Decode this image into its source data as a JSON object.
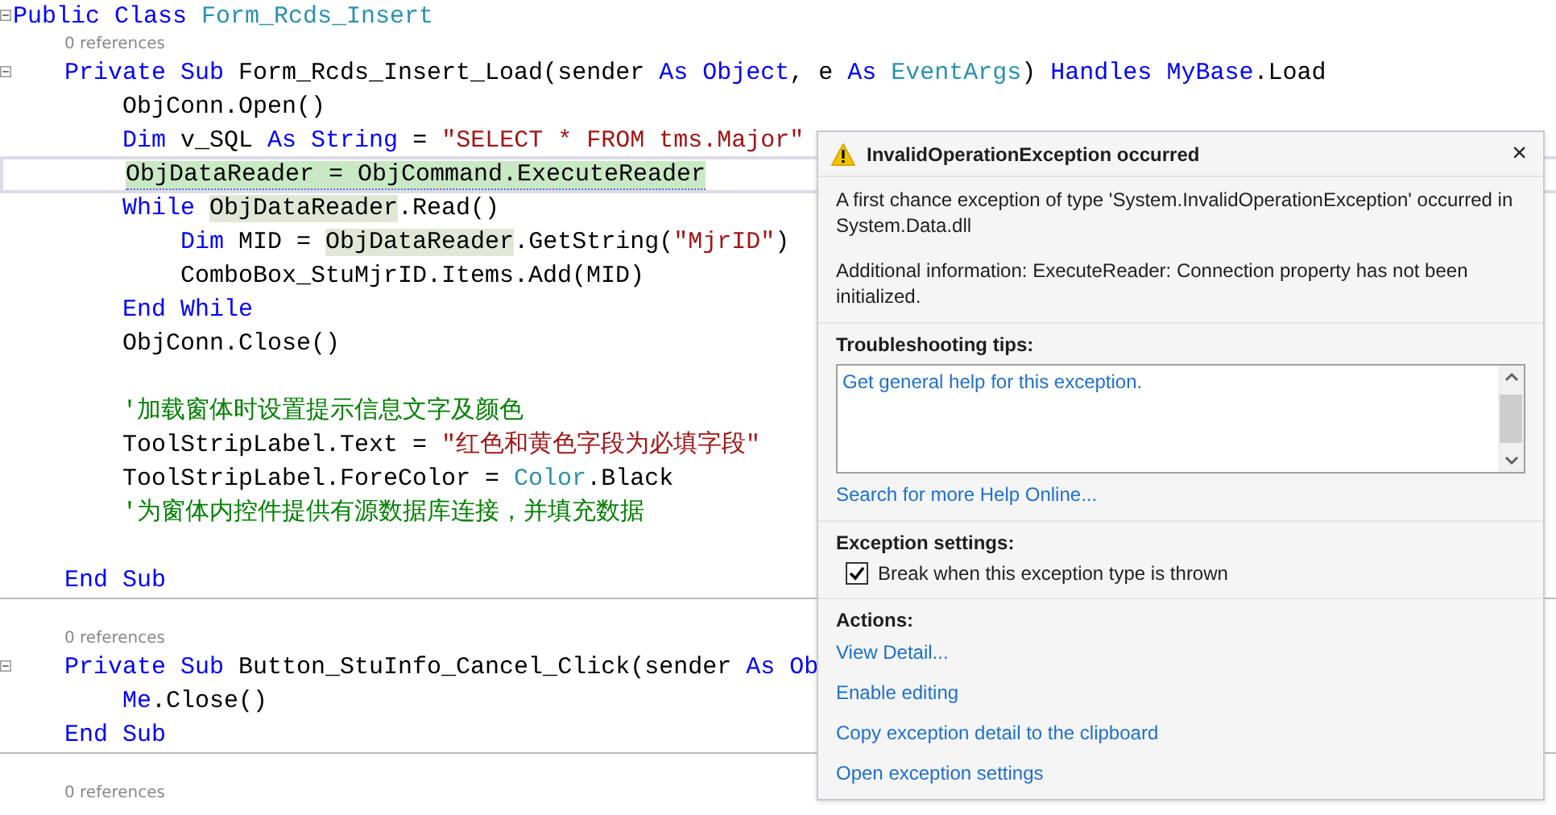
{
  "editor": {
    "lines": [
      {
        "kind": "code",
        "fold": true,
        "tokens": [
          {
            "t": "Public Class ",
            "kind": "kw"
          },
          {
            "t": "Form_Rcds_Insert",
            "kind": "type"
          }
        ],
        "children": [
          {
            "kind": "refs",
            "text": "0 references"
          },
          {
            "kind": "code",
            "fold": true,
            "tokens": [
              {
                "t": "Private Sub ",
                "kind": "kw"
              },
              {
                "t": "Form_Rcds_Insert_Load(sender ",
                "kind": "plain"
              },
              {
                "t": "As ",
                "kind": "kw"
              },
              {
                "t": "Object",
                "kind": "kw"
              },
              {
                "t": ", e ",
                "kind": "plain"
              },
              {
                "t": "As ",
                "kind": "kw"
              },
              {
                "t": "EventArgs",
                "kind": "type"
              },
              {
                "t": ") ",
                "kind": "plain"
              },
              {
                "t": "Handles ",
                "kind": "kw"
              },
              {
                "t": "MyBase",
                "kind": "kw"
              },
              {
                "t": ".Load",
                "kind": "plain"
              }
            ],
            "children": [
              {
                "kind": "code",
                "tokens": [
                  {
                    "t": "ObjConn.Open()",
                    "kind": "plain"
                  }
                ]
              },
              {
                "kind": "code",
                "tokens": [
                  {
                    "t": "Dim ",
                    "kind": "kw"
                  },
                  {
                    "t": "v_SQL ",
                    "kind": "plain"
                  },
                  {
                    "t": "As ",
                    "kind": "kw"
                  },
                  {
                    "t": "String",
                    "kind": "kw"
                  },
                  {
                    "t": " = ",
                    "kind": "plain"
                  },
                  {
                    "t": "\"SELECT * FROM tms.Major\"",
                    "kind": "str"
                  }
                ]
              },
              {
                "kind": "code",
                "current": true,
                "tokens": [
                  {
                    "t": "ObjDataReader = ObjCommand.ExecuteReader",
                    "kind": "active"
                  }
                ]
              },
              {
                "kind": "code",
                "tokens": [
                  {
                    "t": "While ",
                    "kind": "kw"
                  },
                  {
                    "t": "ObjDataReader",
                    "kind": "ref"
                  },
                  {
                    "t": ".Read()",
                    "kind": "plain"
                  }
                ],
                "children": [
                  {
                    "kind": "code",
                    "tokens": [
                      {
                        "t": "Dim ",
                        "kind": "kw"
                      },
                      {
                        "t": "MID = ",
                        "kind": "plain"
                      },
                      {
                        "t": "ObjDataReader",
                        "kind": "ref"
                      },
                      {
                        "t": ".GetString(",
                        "kind": "plain"
                      },
                      {
                        "t": "\"MjrID\"",
                        "kind": "str"
                      },
                      {
                        "t": ")",
                        "kind": "plain"
                      }
                    ]
                  },
                  {
                    "kind": "code",
                    "tokens": [
                      {
                        "t": "ComboBox_StuMjrID.Items.Add(MID)",
                        "kind": "plain"
                      }
                    ]
                  }
                ]
              },
              {
                "kind": "code",
                "tokens": [
                  {
                    "t": "End While",
                    "kind": "kw"
                  }
                ]
              },
              {
                "kind": "code",
                "tokens": [
                  {
                    "t": "ObjConn.Close()",
                    "kind": "plain"
                  }
                ]
              },
              {
                "kind": "blank"
              },
              {
                "kind": "code",
                "tokens": [
                  {
                    "t": "'加载窗体时设置提示信息文字及颜色",
                    "kind": "comment"
                  }
                ]
              },
              {
                "kind": "code",
                "tokens": [
                  {
                    "t": "ToolStripLabel.Text = ",
                    "kind": "plain"
                  },
                  {
                    "t": "\"红色和黄色字段为必填字段\"",
                    "kind": "str"
                  }
                ]
              },
              {
                "kind": "code",
                "tokens": [
                  {
                    "t": "ToolStripLabel.ForeColor = ",
                    "kind": "plain"
                  },
                  {
                    "t": "Color",
                    "kind": "type"
                  },
                  {
                    "t": ".Black",
                    "kind": "plain"
                  }
                ]
              },
              {
                "kind": "code",
                "tokens": [
                  {
                    "t": "'为窗体内控件提供有源数据库连接，并填充数据",
                    "kind": "comment"
                  }
                ]
              },
              {
                "kind": "blank"
              }
            ]
          },
          {
            "kind": "code",
            "tokens": [
              {
                "t": "End Sub",
                "kind": "kw"
              }
            ]
          },
          {
            "kind": "separator"
          },
          {
            "kind": "refs",
            "text": "0 references"
          },
          {
            "kind": "code",
            "fold": true,
            "tokens": [
              {
                "t": "Private Sub ",
                "kind": "kw"
              },
              {
                "t": "Button_StuInfo_Cancel_Click(sender ",
                "kind": "plain"
              },
              {
                "t": "As ",
                "kind": "kw"
              },
              {
                "t": "Ob",
                "kind": "kw"
              }
            ],
            "children": [
              {
                "kind": "code",
                "tokens": [
                  {
                    "t": "Me",
                    "kind": "kw"
                  },
                  {
                    "t": ".Close()",
                    "kind": "plain"
                  }
                ]
              }
            ]
          },
          {
            "kind": "code",
            "tokens": [
              {
                "t": "End Sub",
                "kind": "kw"
              }
            ]
          },
          {
            "kind": "separator"
          },
          {
            "kind": "refs",
            "text": "0 references"
          }
        ]
      }
    ]
  },
  "exception_popup": {
    "title": "InvalidOperationException occurred",
    "close": "×",
    "message": [
      "A first chance exception of type 'System.InvalidOperationException' occurred in System.Data.dll",
      "Additional information: ExecuteReader: Connection property has not been initialized."
    ],
    "troubleshooting": {
      "heading": "Troubleshooting tips:",
      "tips": [
        "Get general help for this exception."
      ],
      "link": "Search for more Help Online..."
    },
    "settings": {
      "heading": "Exception settings:",
      "checkbox": {
        "label": "Break when this exception type is thrown",
        "checked": true
      }
    },
    "actions": {
      "heading": "Actions:",
      "links": [
        "View Detail...",
        "Enable editing",
        "Copy exception detail to the clipboard",
        "Open exception settings"
      ]
    }
  }
}
